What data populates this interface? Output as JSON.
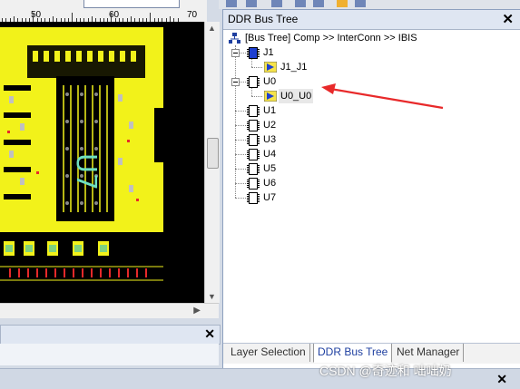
{
  "ruler": {
    "labels": [
      "50",
      "60",
      "70"
    ]
  },
  "panel": {
    "title": "DDR Bus Tree",
    "close_icon": "close-icon",
    "tree": {
      "root_label": "[Bus Tree] Comp >> InterConn >> IBIS",
      "nodes": [
        {
          "label": "J1",
          "expanded": true,
          "icon": "chip-blue-icon",
          "children": [
            {
              "label": "J1_J1",
              "icon": "pin-model-icon"
            }
          ]
        },
        {
          "label": "U0",
          "expanded": true,
          "icon": "chip-icon",
          "children": [
            {
              "label": "U0_U0",
              "icon": "pin-model-icon",
              "selected": true
            }
          ]
        },
        {
          "label": "U1",
          "icon": "chip-icon"
        },
        {
          "label": "U2",
          "icon": "chip-icon"
        },
        {
          "label": "U3",
          "icon": "chip-icon"
        },
        {
          "label": "U4",
          "icon": "chip-icon"
        },
        {
          "label": "U5",
          "icon": "chip-icon"
        },
        {
          "label": "U6",
          "icon": "chip-icon"
        },
        {
          "label": "U7",
          "icon": "chip-icon"
        }
      ]
    },
    "tabs": [
      "Layer Selection",
      "DDR Bus Tree",
      "Net Manager"
    ],
    "active_tab": "DDR Bus Tree"
  },
  "pcb": {
    "silkscreen_text": "U7"
  },
  "watermark": "CSDN @奇迹和  咄咄奶",
  "colors": {
    "board": "#f2f21a",
    "background": "#000000",
    "silk": "#6fe0c0",
    "annotation": "#e8292a",
    "accent": "#1e3fa0"
  }
}
